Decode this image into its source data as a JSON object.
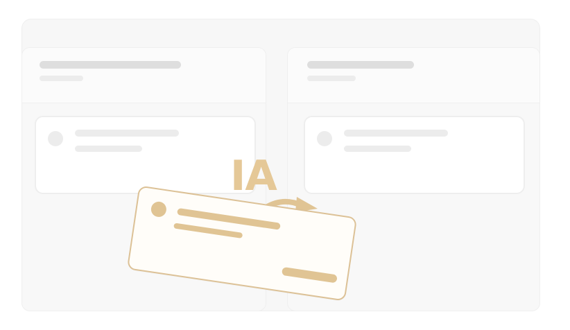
{
  "overlay": {
    "label": "IA"
  },
  "colors": {
    "accent": "#E0C494",
    "accent_text": "#E5C897",
    "skeleton": "#ECECEC",
    "board_bg": "#F7F7F7"
  },
  "icons": {
    "move_arrow": "curved-arrow-right-icon"
  }
}
